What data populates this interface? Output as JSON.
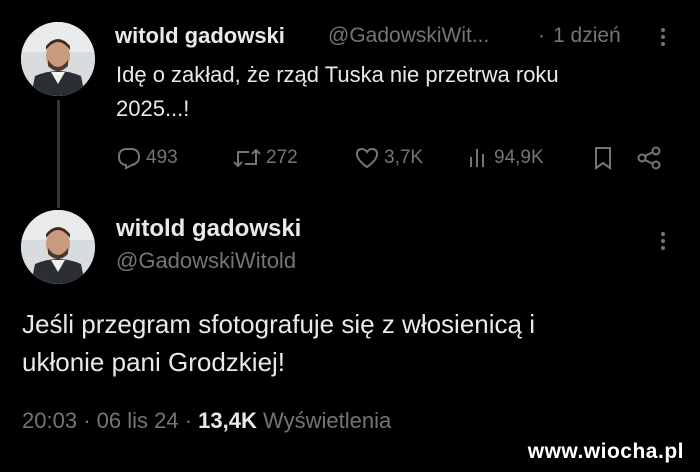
{
  "reply_tweet": {
    "author_name": "witold gadowski",
    "handle": "@GadowskiWit...",
    "separator": "·",
    "time": "1 dzień",
    "text_line1": "Idę o zakład, że rząd Tuska nie przetrwa roku",
    "text_line2": "2025...!",
    "stats": {
      "replies": "493",
      "retweets": "272",
      "likes": "3,7K",
      "views": "94,9K"
    },
    "icons": [
      "reply-icon",
      "retweet-icon",
      "like-icon",
      "views-icon",
      "bookmark-icon",
      "share-icon",
      "more-icon"
    ]
  },
  "main_tweet": {
    "author_name": "witold gadowski",
    "handle": "@GadowskiWitold",
    "text_line1": "Jeśli przegram sfotografuje się z włosienicą i",
    "text_line2": "ukłonie pani Grodzkiej!",
    "meta": {
      "time": "20:03",
      "separator1": "·",
      "date": "06 lis 24",
      "separator2": "·",
      "views_count": "13,4K",
      "views_label": "Wyświetlenia"
    }
  },
  "watermark": "www.wiocha.pl",
  "colors": {
    "background": "#000000",
    "text": "#e7e9ea",
    "muted": "#71767b",
    "thread_line": "#333639"
  }
}
